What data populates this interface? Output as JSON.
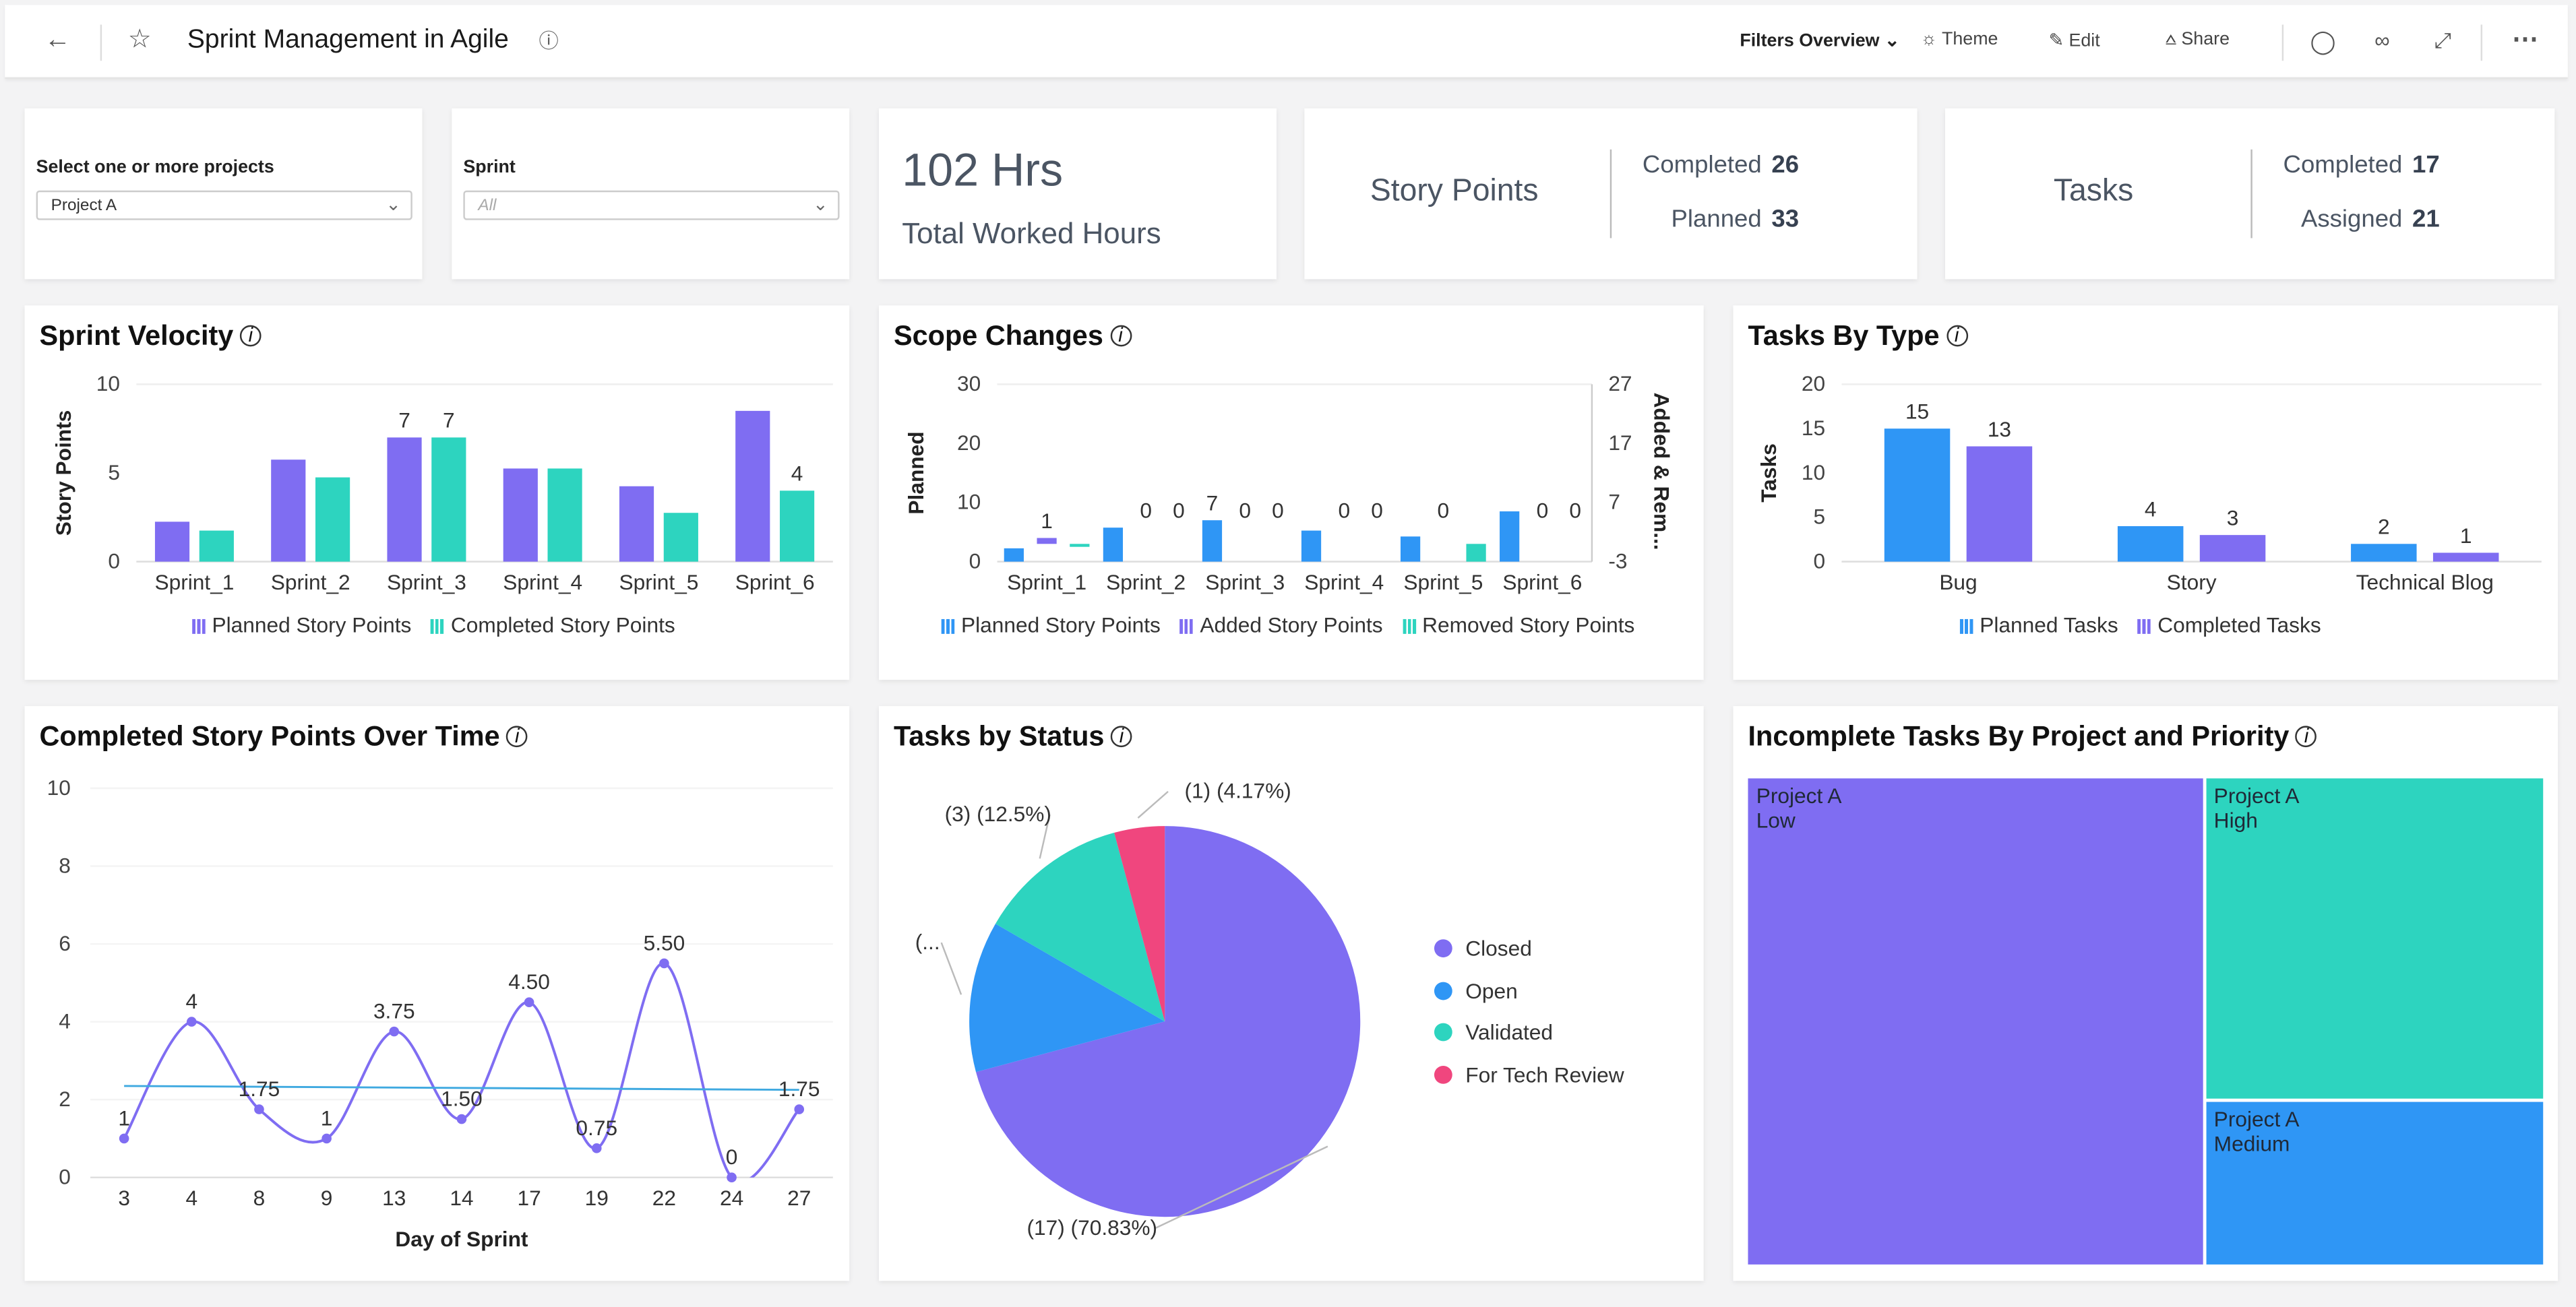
{
  "header": {
    "title": "Sprint Management in Agile",
    "back_icon": "arrow-left-icon",
    "favorite_icon": "star-icon",
    "info_icon": "info-icon",
    "filters_overview": "Filters Overview",
    "theme": "Theme",
    "edit": "Edit",
    "share": "Share",
    "actions": [
      "comment-icon",
      "view-icon",
      "expand-icon",
      "more-icon"
    ]
  },
  "filters": {
    "projects": {
      "label": "Select one or more projects",
      "value": "Project A"
    },
    "sprint": {
      "label": "Sprint",
      "placeholder": "All"
    }
  },
  "kpis": {
    "hours": {
      "value": "102 Hrs",
      "label": "Total Worked Hours"
    },
    "story_points": {
      "label": "Story Points",
      "completed_label": "Completed",
      "completed": "26",
      "planned_label": "Planned",
      "planned": "33"
    },
    "tasks": {
      "label": "Tasks",
      "completed_label": "Completed",
      "completed": "17",
      "assigned_label": "Assigned",
      "assigned": "21"
    }
  },
  "colors": {
    "purple": "#7f6df2",
    "teal": "#2dd4bf",
    "blue": "#2f96f5",
    "pink": "#f0467e",
    "trend": "#3fa9e0"
  },
  "chart_data": [
    {
      "id": "sprint_velocity",
      "type": "bar",
      "title": "Sprint Velocity",
      "ylabel": "Story Points",
      "xlabel": "",
      "ylim": [
        0,
        10
      ],
      "yticks": [
        0,
        5,
        10
      ],
      "categories": [
        "Sprint_1",
        "Sprint_2",
        "Sprint_3",
        "Sprint_4",
        "Sprint_5",
        "Sprint_6"
      ],
      "series": [
        {
          "name": "Planned Story Points",
          "color": "#7f6df2",
          "values": [
            2.25,
            5.75,
            7,
            5.25,
            4.25,
            8.5
          ],
          "labels": [
            "",
            "",
            "7",
            "",
            "",
            ""
          ]
        },
        {
          "name": "Completed Story Points",
          "color": "#2dd4bf",
          "values": [
            1.75,
            4.75,
            7,
            5.25,
            2.75,
            4
          ],
          "labels": [
            "",
            "",
            "7",
            "",
            "",
            "4"
          ]
        }
      ],
      "legend": "bottom"
    },
    {
      "id": "scope_changes",
      "type": "bar",
      "title": "Scope Changes",
      "ylabel": "Planned",
      "y2label": "Added & Rem...",
      "ylim": [
        0,
        30
      ],
      "yticks": [
        0,
        10,
        20,
        30
      ],
      "y2lim": [
        -3,
        27
      ],
      "y2ticks": [
        -3,
        7,
        17,
        27
      ],
      "categories": [
        "Sprint_1",
        "Sprint_2",
        "Sprint_3",
        "Sprint_4",
        "Sprint_5",
        "Sprint_6"
      ],
      "series": [
        {
          "name": "Planned Story Points",
          "color": "#2f96f5",
          "axis": "left",
          "values": [
            2.25,
            5.75,
            7,
            5.25,
            4.25,
            8.5
          ],
          "labels": [
            "",
            "",
            "7",
            "",
            "",
            ""
          ]
        },
        {
          "name": "Added Story Points",
          "color": "#7f6df2",
          "axis": "right",
          "values": [
            1,
            0,
            0,
            0,
            0,
            0
          ],
          "labels": [
            "1",
            "0",
            "0",
            "0",
            "0",
            "0"
          ]
        },
        {
          "name": "Removed Story Points",
          "color": "#2dd4bf",
          "axis": "right",
          "values": [
            -0.5,
            0,
            0,
            0,
            -3,
            0
          ],
          "labels": [
            "",
            "0",
            "0",
            "0",
            "",
            "0"
          ]
        }
      ],
      "legend": "bottom"
    },
    {
      "id": "tasks_by_type",
      "type": "bar",
      "title": "Tasks By Type",
      "ylabel": "Tasks",
      "ylim": [
        0,
        20
      ],
      "yticks": [
        0,
        5,
        10,
        15,
        20
      ],
      "categories": [
        "Bug",
        "Story",
        "Technical Blog"
      ],
      "series": [
        {
          "name": "Planned Tasks",
          "color": "#2f96f5",
          "values": [
            15,
            4,
            2
          ],
          "labels": [
            "15",
            "4",
            "2"
          ]
        },
        {
          "name": "Completed Tasks",
          "color": "#7f6df2",
          "values": [
            13,
            3,
            1
          ],
          "labels": [
            "13",
            "3",
            "1"
          ]
        }
      ],
      "legend": "bottom"
    },
    {
      "id": "completed_over_time",
      "type": "line",
      "title": "Completed Story Points Over Time",
      "xlabel": "Day of Sprint",
      "ylabel": "",
      "ylim": [
        0,
        10
      ],
      "yticks": [
        0,
        2,
        4,
        6,
        8,
        10
      ],
      "x": [
        "3",
        "4",
        "8",
        "9",
        "13",
        "14",
        "17",
        "19",
        "22",
        "24",
        "27"
      ],
      "series": [
        {
          "name": "Completed Story Points",
          "color": "#7f6df2",
          "values": [
            1,
            4,
            1.75,
            1,
            3.75,
            1.5,
            4.5,
            0.75,
            5.5,
            0,
            1.75
          ],
          "labels": [
            "1",
            "4",
            "1.75",
            "1",
            "3.75",
            "1.50",
            "4.50",
            "0.75",
            "5.50",
            "0",
            "1.75"
          ]
        },
        {
          "name": "Trend",
          "color": "#3fa9e0",
          "values": [
            2.35,
            2.25
          ]
        }
      ]
    },
    {
      "id": "tasks_by_status",
      "type": "pie",
      "title": "Tasks by Status",
      "slices": [
        {
          "label": "Closed",
          "value": 17,
          "percent": 70.83,
          "color": "#7f6df2",
          "text": "(17) (70.83%)"
        },
        {
          "label": "Open",
          "value": 3,
          "percent": 12.5,
          "color": "#2f96f5",
          "text": "(..."
        },
        {
          "label": "Validated",
          "value": 3,
          "percent": 12.5,
          "color": "#2dd4bf",
          "text": "(3) (12.5%)"
        },
        {
          "label": "For Tech Review",
          "value": 1,
          "percent": 4.17,
          "color": "#f0467e",
          "text": "(1) (4.17%)"
        }
      ],
      "legend": "right"
    },
    {
      "id": "incomplete_tasks",
      "type": "treemap",
      "title": "Incomplete Tasks By Project and Priority",
      "nodes": [
        {
          "project": "Project A",
          "priority": "Low",
          "value": 4,
          "color": "#7f6df2"
        },
        {
          "project": "Project A",
          "priority": "High",
          "value": 2,
          "color": "#2dd4bf"
        },
        {
          "project": "Project A",
          "priority": "Medium",
          "value": 1,
          "color": "#2f96f5"
        }
      ]
    }
  ]
}
